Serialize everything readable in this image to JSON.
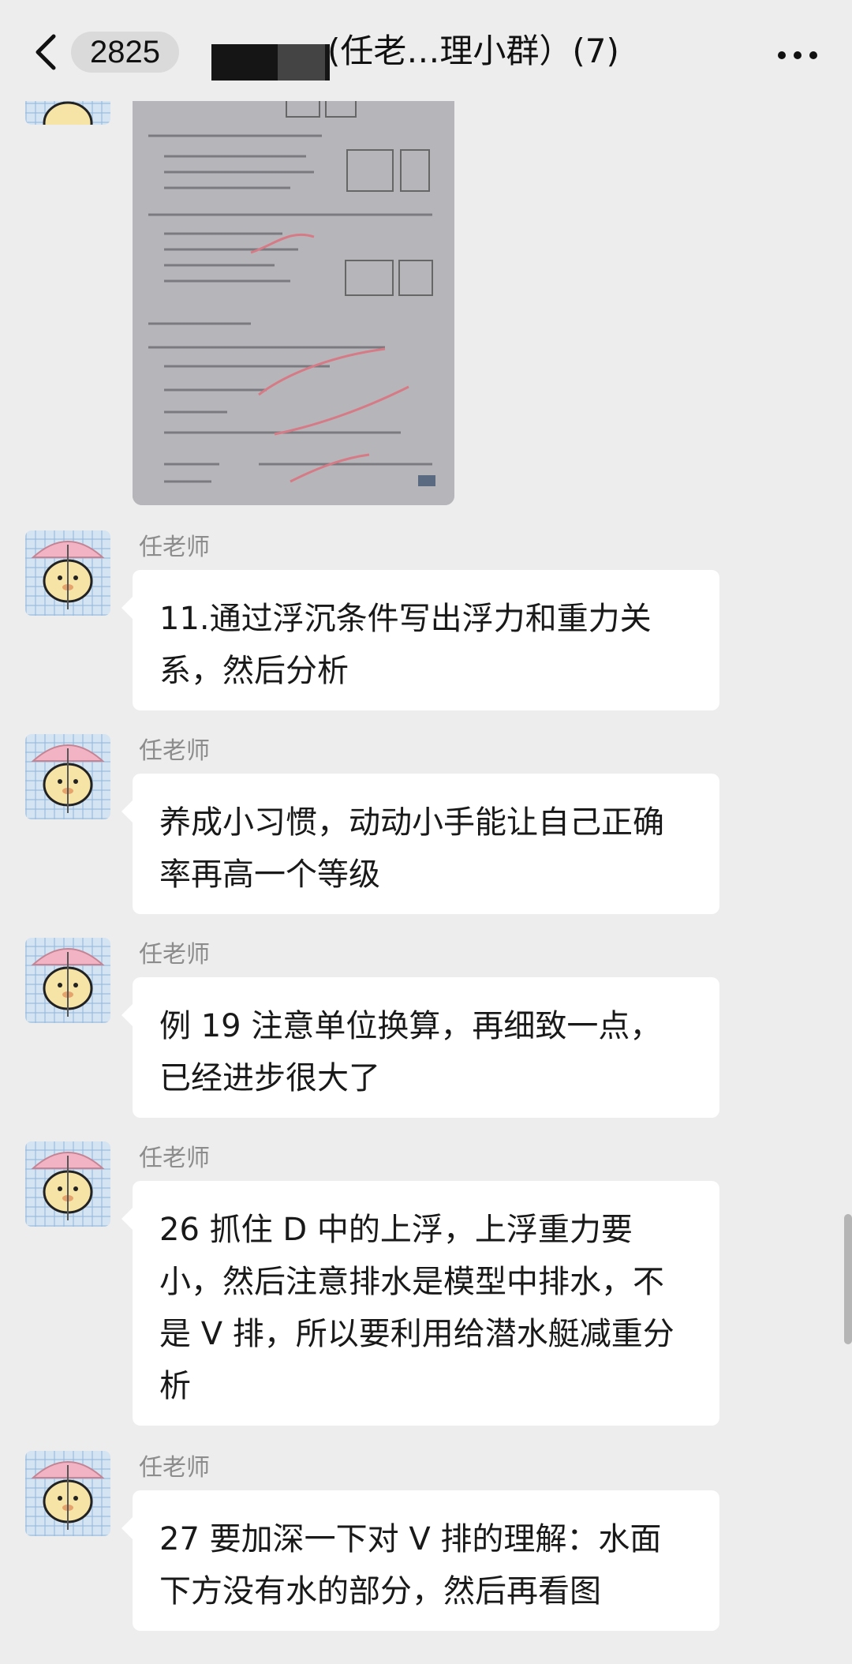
{
  "header": {
    "unread_count": "2825",
    "title": "(任老…理小群）(7)"
  },
  "messages": [
    {
      "sender": "任老师",
      "text": "11.通过浮沉条件写出浮力和重力关系，然后分析"
    },
    {
      "sender": "任老师",
      "text": "养成小习惯，动动小手能让自己正确率再高一个等级"
    },
    {
      "sender": "任老师",
      "text": "例 19 注意单位换算，再细致一点，已经进步很大了"
    },
    {
      "sender": "任老师",
      "text": "26 抓住 D 中的上浮，上浮重力要小，然后注意排水是模型中排水，不是 V 排，所以要利用给潜水艇减重分析"
    },
    {
      "sender": "任老师",
      "text": "27 要加深一下对 V 排的理解：水面下方没有水的部分，然后再看图"
    }
  ],
  "icons": [
    "back-icon",
    "more-icon"
  ],
  "colors": {
    "background": "#ededed",
    "bubble": "#ffffff",
    "sender_name": "#8c8c8c"
  }
}
